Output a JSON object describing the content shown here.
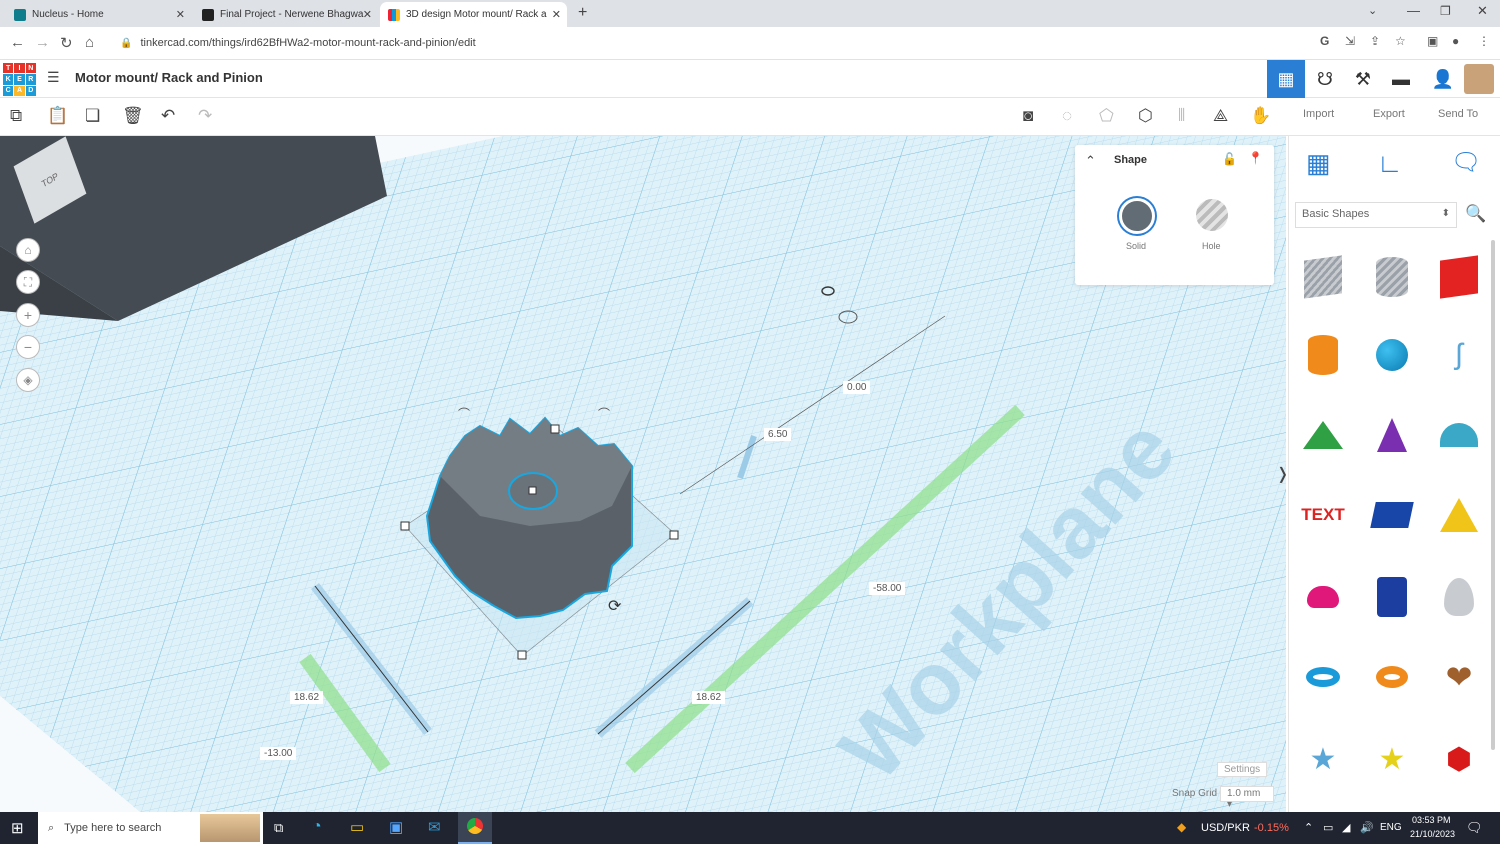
{
  "browser": {
    "tabs": [
      {
        "title": "Nucleus - Home"
      },
      {
        "title": "Final Project - Nerwene Bhagwa"
      },
      {
        "title": "3D design Motor mount/ Rack a"
      }
    ],
    "url": "tinkercad.com/things/ird62BfHWa2-motor-mount-rack-and-pinion/edit"
  },
  "app": {
    "logo_letters": [
      "T",
      "I",
      "N",
      "K",
      "E",
      "R",
      "C",
      "A",
      "D"
    ],
    "title": "Motor mount/ Rack and Pinion",
    "import_label": "Import",
    "export_label": "Export",
    "sendto_label": "Send To"
  },
  "inspector": {
    "title": "Shape",
    "solid_label": "Solid",
    "hole_label": "Hole"
  },
  "library": {
    "selected": "Basic Shapes",
    "shapes": [
      "box",
      "cylinder-striped",
      "box-red",
      "cylinder-orange",
      "sphere-blue",
      "scribble",
      "roof-green",
      "cone-purple",
      "round-roof",
      "text",
      "polygon-blue",
      "pyramid-yellow",
      "half-sphere",
      "polygon-blue-hex",
      "paraboloid",
      "torus-blue",
      "tube-orange",
      "heart-brown",
      "star-blue",
      "star-yellow",
      "icosahedron-red"
    ]
  },
  "viewport": {
    "view_cube": "TOP",
    "workplane_text": "Workplane",
    "dims": {
      "d1": "0.00",
      "d2": "6.50",
      "d3": "-58.00",
      "d4": "18.62",
      "d5": "18.62",
      "d6": "-13.00"
    },
    "settings_label": "Settings",
    "snap_label": "Snap Grid",
    "snap_value": "1.0 mm"
  },
  "taskbar": {
    "search": "Type here to search",
    "ticker": "USD/PKR",
    "ticker_change": "-0.15%",
    "lang": "ENG",
    "time": "03:53 PM",
    "date": "21/10/2023"
  },
  "colors": {
    "accent": "#2a7fd4",
    "workplane": "#d6eef8",
    "solid": "#626c74"
  }
}
